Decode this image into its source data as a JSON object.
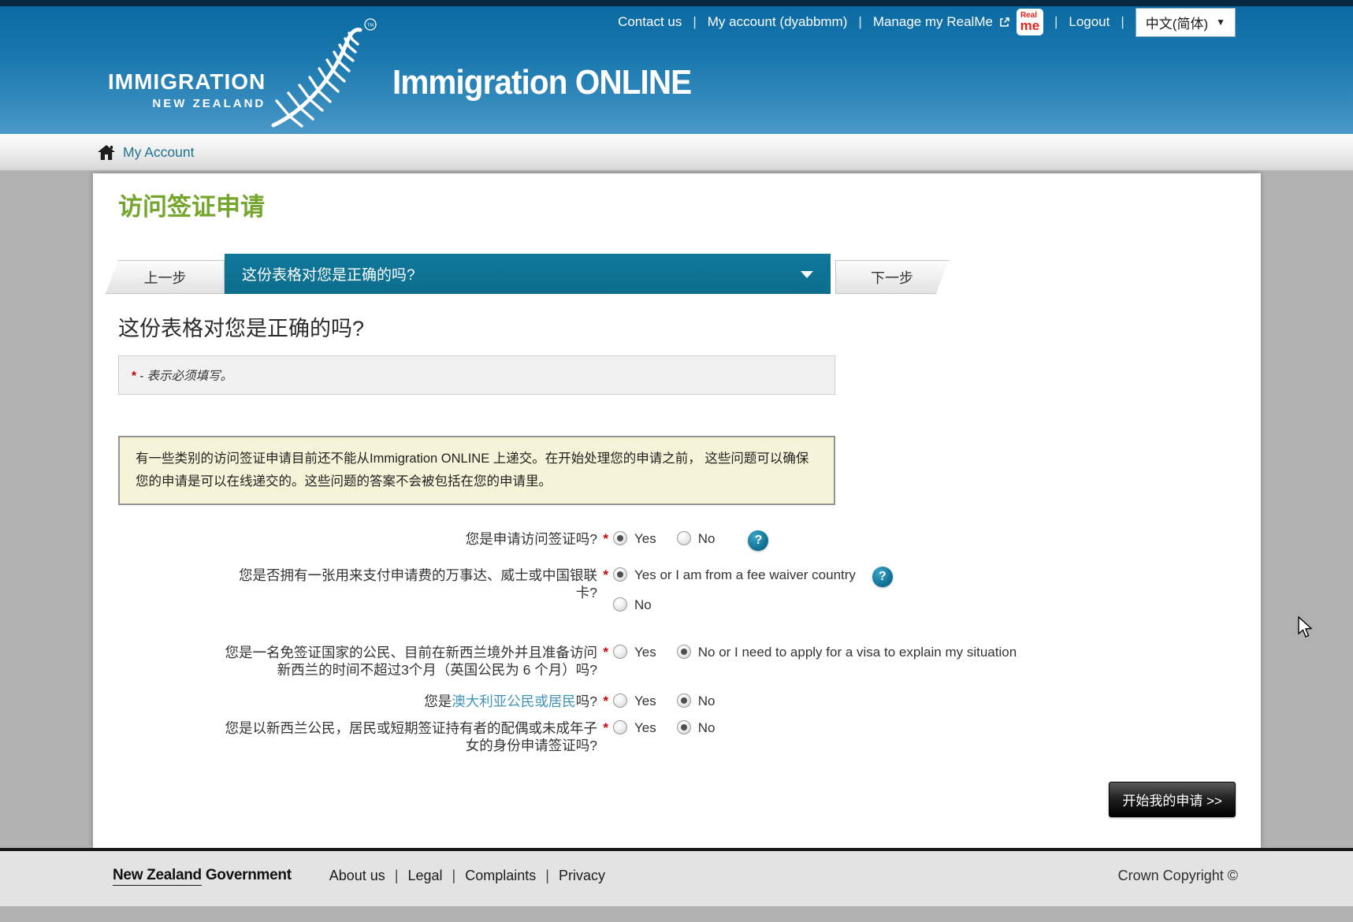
{
  "colors": {
    "header_blue_top": "#0a68a2",
    "header_blue_bottom": "#4a9aca",
    "teal_accent": "#0d6e8e",
    "green_heading": "#74a52d",
    "required_red": "#cc0000",
    "info_box_bg": "#f6f4d8",
    "link_teal": "#1a7391"
  },
  "header": {
    "top_nav": {
      "contact_us": "Contact us",
      "my_account": "My account (dyabbmm)",
      "manage_realme": "Manage my RealMe",
      "realme_badge_top": "Real",
      "realme_badge_bottom": "me",
      "logout": "Logout",
      "language": "中文(简体)",
      "language_caret": "▼",
      "separator": "|"
    },
    "brand": {
      "wordmark_line1": "IMMIGRATION",
      "wordmark_line2": "NEW ZEALAND",
      "trademark": "TM",
      "product_name": "Immigration ONLINE"
    }
  },
  "breadcrumb": {
    "my_account": "My Account"
  },
  "main": {
    "page_title": "访问签证申请",
    "step_nav": {
      "prev_label": "上一步",
      "current_step": "这份表格对您是正确的吗?",
      "next_label": "下一步"
    },
    "section_heading": "这份表格对您是正确的吗?",
    "required_mark": "*",
    "required_note": "- 表示必须填写。",
    "info_text": "有一些类别的访问签证申请目前还不能从Immigration ONLINE 上递交。在开始处理您的申请之前， 这些问题可以确保您的申请是可以在线递交的。这些问题的答案不会被包括在您的申请里。",
    "help_mark": "?",
    "questions": [
      {
        "label": "您是申请访问签证吗?",
        "options": [
          {
            "label": "Yes",
            "selected": true
          },
          {
            "label": "No",
            "selected": false
          }
        ],
        "has_help": true
      },
      {
        "label": "您是否拥有一张用来支付申请费的万事达、威士或中国银联卡?",
        "options": [
          {
            "label": "Yes or I am from a fee waiver country",
            "selected": true,
            "has_help": true
          },
          {
            "label": "No",
            "selected": false
          }
        ]
      },
      {
        "label": "您是一名免签证国家的公民、目前在新西兰境外并且准备访问新西兰的时间不超过3个月（英国公民为 6 个月）吗?",
        "options": [
          {
            "label": "Yes",
            "selected": false
          },
          {
            "label": "No or I need to apply for a visa to explain my situation",
            "selected": true
          }
        ]
      },
      {
        "label_prefix": "您是",
        "label_link": "澳大利亚公民或居民",
        "label_suffix": "吗?",
        "options": [
          {
            "label": "Yes",
            "selected": false
          },
          {
            "label": "No",
            "selected": true
          }
        ]
      },
      {
        "label": "您是以新西兰公民，居民或短期签证持有者的配偶或未成年子女的身份申请签证吗?",
        "options": [
          {
            "label": "Yes",
            "selected": false
          },
          {
            "label": "No",
            "selected": true
          }
        ]
      }
    ],
    "submit_label": "开始我的申请 >>"
  },
  "footer": {
    "govt_logo_new_zealand": "New Zealand",
    "govt_logo_government": "Government",
    "links": {
      "about": "About us",
      "legal": "Legal",
      "complaints": "Complaints",
      "privacy": "Privacy",
      "separator": "|"
    },
    "copyright": "Crown Copyright ©"
  }
}
